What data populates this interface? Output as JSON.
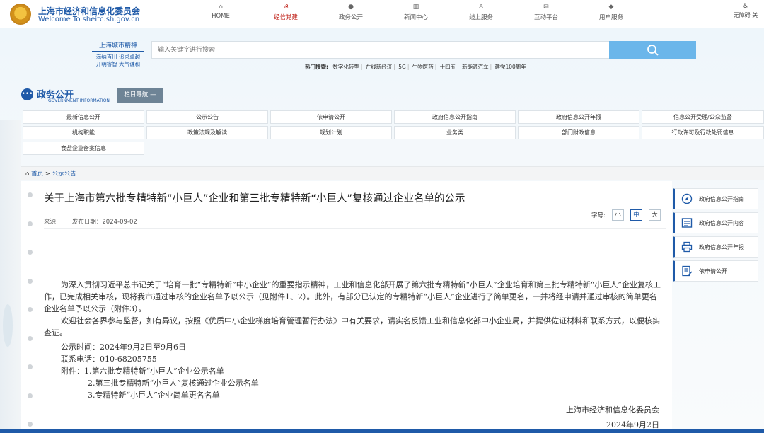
{
  "header": {
    "site_title": "上海市经济和信息化委员会",
    "site_sub": "Welcome To sheitc.sh.gov.cn",
    "nav": [
      {
        "label": "HOME",
        "icon": "home-icon",
        "glyph": "⌂"
      },
      {
        "label": "经信党建",
        "icon": "party-emblem-icon",
        "glyph": "☭"
      },
      {
        "label": "政务公开",
        "icon": "chat-icon",
        "glyph": "●"
      },
      {
        "label": "新闻中心",
        "icon": "news-icon",
        "glyph": "▥"
      },
      {
        "label": "线上服务",
        "icon": "user-service-icon",
        "glyph": "♙"
      },
      {
        "label": "互动平台",
        "icon": "interaction-icon",
        "glyph": "✉"
      },
      {
        "label": "用户服务",
        "icon": "diamond-icon",
        "glyph": "◆"
      }
    ],
    "accessibility": {
      "label": "无障碍 关",
      "icon": "accessibility-icon",
      "glyph": "♿"
    }
  },
  "slogan": {
    "title": "上海城市精神",
    "line1": "海纳百川 追求卓越",
    "line2": "开明睿智 大气谦和"
  },
  "search": {
    "placeholder": "输入关键字进行搜索",
    "hot_label": "热门搜索:",
    "hot_keywords": [
      "数字化转型",
      "在线新经济",
      "5G",
      "生物医药",
      "十四五",
      "新能源汽车",
      "建党100周年"
    ]
  },
  "section": {
    "title": "政务公开",
    "subtitle": "GOVERNMENT INFORMATION",
    "column_nav": "栏目导航 —"
  },
  "grid": {
    "rows": [
      [
        "最新信息公开",
        "公示公告",
        "依申请公开",
        "政府信息公开指南",
        "政府信息公开年报",
        "信息公开受理/公众监督"
      ],
      [
        "机构职能",
        "政策法规及解读",
        "规划计划",
        "业务类",
        "部门财政信息",
        "行政许可及行政处罚信息"
      ],
      [
        "食盐企业备案信息"
      ]
    ]
  },
  "breadcrumb": {
    "home": "首页",
    "sep": ">",
    "current": "公示公告"
  },
  "article": {
    "title": "关于上海市第六批专精特新“小巨人”企业和第三批专精特新“小巨人”复核通过企业名单的公示",
    "source_label": "来源:",
    "date_label": "发布日期：2024-09-02",
    "font_size_label": "字号:",
    "font_sizes": [
      "小",
      "中",
      "大"
    ],
    "para1": "为深入贯彻习近平总书记关于“培育一批“专精特新”中小企业”的重要指示精神，工业和信息化部开展了第六批专精特新“小巨人”企业培育和第三批专精特新“小巨人”企业复核工作，已完成相关审核，现将我市通过审核的企业名单予以公示（见附件1、2）。此外，有部分已认定的专精特新“小巨人”企业进行了简单更名，一并将经申请并通过审核的简单更名企业名单予以公示（附件3）。",
    "para2": "欢迎社会各界参与监督，如有异议，按照《优质中小企业梯度培育管理暂行办法》中有关要求，请实名反馈工业和信息化部中小企业局，并提供佐证材料和联系方式，以便核实查证。",
    "publicity_time": "公示时间：2024年9月2日至9月6日",
    "phone": "联系电话：010-68205755",
    "attach1": "附件：1.第六批专精特新“小巨人”企业公示名单",
    "attach2": "2.第三批专精特新“小巨人”复核通过企业公示名单",
    "attach3": "3.专精特新“小巨人”企业简单更名名单",
    "signature": "上海市经济和信息化委员会",
    "sign_date": "2024年9月2日"
  },
  "sidebar": {
    "items": [
      {
        "label": "政府信息公开指南",
        "icon": "compass-icon"
      },
      {
        "label": "政府信息公开内容",
        "icon": "list-icon"
      },
      {
        "label": "政府信息公开年报",
        "icon": "printer-icon"
      },
      {
        "label": "依申请公开",
        "icon": "form-edit-icon"
      }
    ]
  },
  "colors": {
    "brand": "#1f5aa8",
    "active_nav": "#c0221a",
    "search_button": "#6bb6ea"
  }
}
